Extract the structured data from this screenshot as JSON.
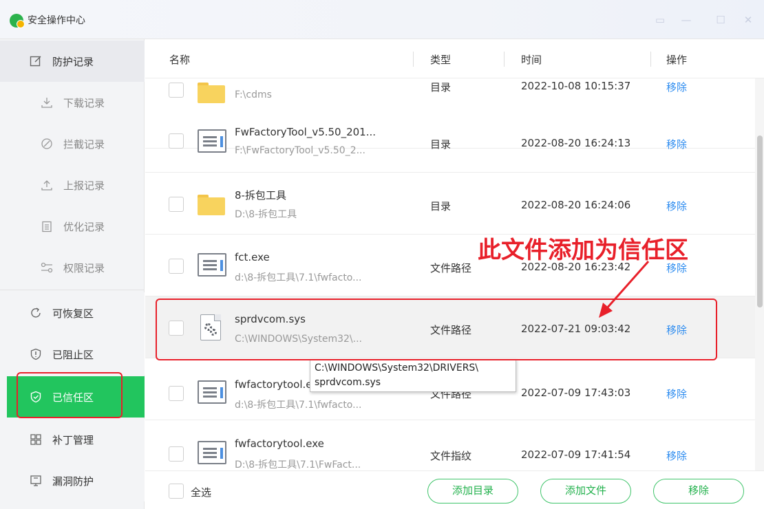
{
  "window": {
    "title": "安全操作中心",
    "controls": [
      "feedback-icon",
      "minimize-icon",
      "maximize-icon",
      "close-icon"
    ]
  },
  "sidebar": {
    "protect_record": "防护记录",
    "sub_items": [
      "下载记录",
      "拦截记录",
      "上报记录",
      "优化记录",
      "权限记录"
    ],
    "recoverable": "可恢复区",
    "blocked": "已阻止区",
    "trusted": "已信任区",
    "patch": "补丁管理",
    "vuln": "漏洞防护"
  },
  "columns": {
    "name": "名称",
    "type": "类型",
    "time": "时间",
    "action": "操作"
  },
  "rows": [
    {
      "name": "",
      "path": "F:\\cdms",
      "type": "目录",
      "time": "2022-10-08 10:15:37",
      "action": "移除",
      "icon": "folder-icon"
    },
    {
      "name": "FwFactoryTool_v5.50_201...",
      "path": "F:\\FwFactoryTool_v5.50_2...",
      "type": "目录",
      "time": "2022-08-20 16:24:13",
      "action": "移除",
      "icon": "document-list-icon"
    },
    {
      "name": "8-拆包工具",
      "path": "D:\\8-拆包工具",
      "type": "目录",
      "time": "2022-08-20 16:24:06",
      "action": "移除",
      "icon": "folder-icon"
    },
    {
      "name": "fct.exe",
      "path": "d:\\8-拆包工具\\7.1\\fwfacto...",
      "type": "文件路径",
      "time": "2022-08-20 16:23:42",
      "action": "移除",
      "icon": "document-list-icon"
    },
    {
      "name": "sprdvcom.sys",
      "path": "C:\\WINDOWS\\System32\\...",
      "type": "文件路径",
      "time": "2022-07-21 09:03:42",
      "action": "移除",
      "icon": "system-file-icon"
    },
    {
      "name": "fwfactorytool.exe",
      "path": "d:\\8-拆包工具\\7.1\\fwfacto...",
      "type": "文件路径",
      "time": "2022-07-09 17:43:03",
      "action": "移除",
      "icon": "document-list-icon"
    },
    {
      "name": "fwfactorytool.exe",
      "path": "D:\\8-拆包工具\\7.1\\FwFact...",
      "type": "文件指纹",
      "time": "2022-07-09 17:41:54",
      "action": "移除",
      "icon": "document-list-icon"
    }
  ],
  "tooltip": {
    "line1": "C:\\WINDOWS\\System32\\DRIVERS\\",
    "line2": "sprdvcom.sys"
  },
  "annotation": {
    "text": "此文件添加为信任区",
    "color": "#e8202a"
  },
  "footer": {
    "select_all": "全选",
    "add_dir": "添加目录",
    "add_file": "添加文件",
    "remove": "移除"
  },
  "colors": {
    "accent": "#22c55e",
    "link": "#2d8cf0",
    "annotation": "#e8202a"
  }
}
